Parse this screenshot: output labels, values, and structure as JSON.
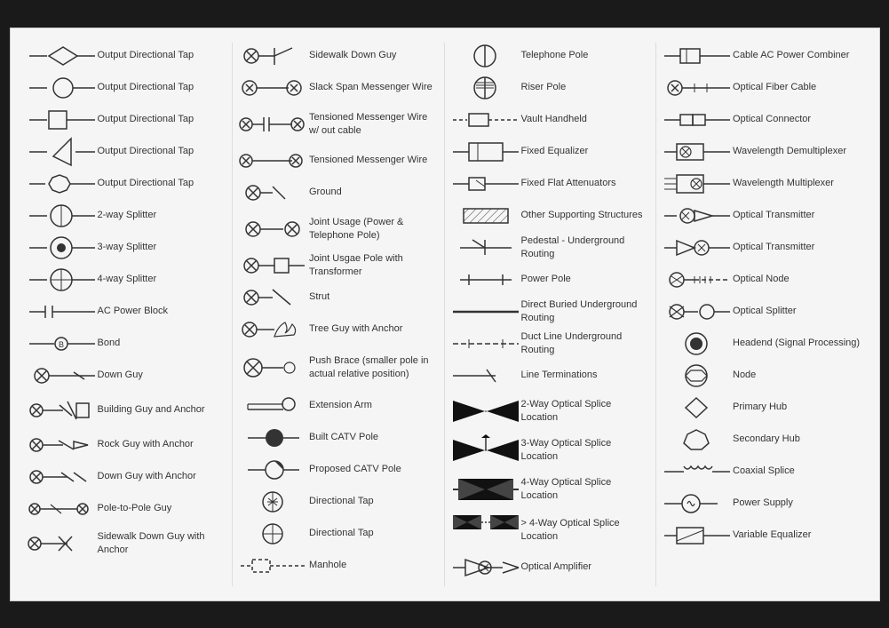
{
  "columns": [
    {
      "id": "col1",
      "items": [
        {
          "id": "odt-diamond",
          "label": "Output Directional Tap",
          "symbol": "diamond-line"
        },
        {
          "id": "odt-circle",
          "label": "Output Directional Tap",
          "symbol": "circle-line"
        },
        {
          "id": "odt-square",
          "label": "Output Directional Tap",
          "symbol": "square-line"
        },
        {
          "id": "odt-triangle",
          "label": "Output Directional Tap",
          "symbol": "triangle-line"
        },
        {
          "id": "odt-hex",
          "label": "Output Directional Tap",
          "symbol": "hex-line"
        },
        {
          "id": "2way",
          "label": "2-way Splitter",
          "symbol": "2way-splitter"
        },
        {
          "id": "3way",
          "label": "3-way Splitter",
          "symbol": "3way-splitter"
        },
        {
          "id": "4way",
          "label": "4-way Splitter",
          "symbol": "4way-splitter"
        },
        {
          "id": "acpb",
          "label": "AC Power Block",
          "symbol": "ac-power-block"
        },
        {
          "id": "bond",
          "label": "Bond",
          "symbol": "bond"
        },
        {
          "id": "downguy",
          "label": "Down Guy",
          "symbol": "down-guy"
        },
        {
          "id": "bldgguy",
          "label": "Building Guy and Anchor",
          "symbol": "building-guy"
        },
        {
          "id": "rockguy",
          "label": "Rock Guy with Anchor",
          "symbol": "rock-guy"
        },
        {
          "id": "downguyanchor",
          "label": "Down Guy with Anchor",
          "symbol": "down-guy-anchor"
        },
        {
          "id": "p2p",
          "label": "Pole-to-Pole Guy",
          "symbol": "pole-to-pole"
        },
        {
          "id": "sidewalkguy",
          "label": "Sidewalk Down Guy with Anchor",
          "symbol": "sidewalk-guy"
        }
      ]
    },
    {
      "id": "col2",
      "items": [
        {
          "id": "sidewalkdg",
          "label": "Sidewalk Down Guy",
          "symbol": "sidewalk-down-guy"
        },
        {
          "id": "slackspan",
          "label": "Slack Span Messenger Wire",
          "symbol": "slack-span"
        },
        {
          "id": "tensioned-wc",
          "label": "Tensioned Messenger Wire w/ out cable",
          "symbol": "tensioned-wo-cable"
        },
        {
          "id": "tensioned",
          "label": "Tensioned Messenger Wire",
          "symbol": "tensioned"
        },
        {
          "id": "ground",
          "label": "Ground",
          "symbol": "ground"
        },
        {
          "id": "joint-usage",
          "label": "Joint Usage (Power & Telephone Pole)",
          "symbol": "joint-usage"
        },
        {
          "id": "joint-trans",
          "label": "Joint Usgae Pole with Transformer",
          "symbol": "joint-transformer"
        },
        {
          "id": "strut",
          "label": "Strut",
          "symbol": "strut"
        },
        {
          "id": "treeguy",
          "label": "Tree Guy with Anchor",
          "symbol": "tree-guy"
        },
        {
          "id": "pushbrace",
          "label": "Push Brace (smaller pole in actual relative position)",
          "symbol": "push-brace"
        },
        {
          "id": "extarm",
          "label": "Extension Arm",
          "symbol": "ext-arm"
        },
        {
          "id": "builtcatv",
          "label": "Built CATV Pole",
          "symbol": "built-catv"
        },
        {
          "id": "proposedcatv",
          "label": "Proposed CATV Pole",
          "symbol": "proposed-catv"
        },
        {
          "id": "dirtap",
          "label": "Directional Tap",
          "symbol": "dir-tap-1"
        },
        {
          "id": "dirtap2",
          "label": "Directional Tap",
          "symbol": "dir-tap-2"
        },
        {
          "id": "manhole",
          "label": "Manhole",
          "symbol": "manhole"
        }
      ]
    },
    {
      "id": "col3",
      "items": [
        {
          "id": "telpole",
          "label": "Telephone Pole",
          "symbol": "telephone-pole"
        },
        {
          "id": "riserpole",
          "label": "Riser Pole",
          "symbol": "riser-pole"
        },
        {
          "id": "vaulthh",
          "label": "Vault Handheld",
          "symbol": "vault-handheld"
        },
        {
          "id": "fixedeq",
          "label": "Fixed Equalizer",
          "symbol": "fixed-equalizer"
        },
        {
          "id": "fixedflat",
          "label": "Fixed Flat Attenuators",
          "symbol": "fixed-flat-att"
        },
        {
          "id": "othersupport",
          "label": "Other Supporting Structures",
          "symbol": "other-support"
        },
        {
          "id": "pedestal",
          "label": "Pedestal - Underground Routing",
          "symbol": "pedestal"
        },
        {
          "id": "powerpole",
          "label": "Power Pole",
          "symbol": "power-pole"
        },
        {
          "id": "directburied",
          "label": "Direct Buried Underground Routing",
          "symbol": "direct-buried"
        },
        {
          "id": "ductline",
          "label": "Duct Line Underground Routing",
          "symbol": "duct-line"
        },
        {
          "id": "linetermination",
          "label": "Line Terminations",
          "symbol": "line-term"
        },
        {
          "id": "2way-optical",
          "label": "2-Way Optical Splice Location",
          "symbol": "2way-optical"
        },
        {
          "id": "3way-optical",
          "label": "3-Way Optical Splice Location",
          "symbol": "3way-optical"
        },
        {
          "id": "4way-optical",
          "label": "4-Way Optical Splice Location",
          "symbol": "4way-optical"
        },
        {
          "id": "4wayplus-optical",
          "label": "> 4-Way Optical Splice Location",
          "symbol": "4wayplus-optical"
        },
        {
          "id": "opticalamp",
          "label": "Optical Amplifier",
          "symbol": "optical-amp"
        }
      ]
    },
    {
      "id": "col4",
      "items": [
        {
          "id": "cableac",
          "label": "Cable AC Power Combiner",
          "symbol": "cable-ac"
        },
        {
          "id": "optfiber",
          "label": "Optical Fiber Cable",
          "symbol": "opt-fiber"
        },
        {
          "id": "optconn",
          "label": "Optical Connector",
          "symbol": "opt-connector"
        },
        {
          "id": "wavdemux",
          "label": "Wavelength Demultiplexer",
          "symbol": "wav-demux"
        },
        {
          "id": "wavmux",
          "label": "Wavelength Multiplexer",
          "symbol": "wav-mux"
        },
        {
          "id": "opttrans1",
          "label": "Optical Transmitter",
          "symbol": "opt-trans1"
        },
        {
          "id": "opttrans2",
          "label": "Optical Transmitter",
          "symbol": "opt-trans2"
        },
        {
          "id": "optnode",
          "label": "Optical Node",
          "symbol": "opt-node"
        },
        {
          "id": "optsplit",
          "label": "Optical Splitter",
          "symbol": "opt-splitter"
        },
        {
          "id": "headend",
          "label": "Headend (Signal Processing)",
          "symbol": "headend"
        },
        {
          "id": "node",
          "label": "Node",
          "symbol": "node-sym"
        },
        {
          "id": "primaryhub",
          "label": "Primary Hub",
          "symbol": "primary-hub"
        },
        {
          "id": "secondaryhub",
          "label": "Secondary Hub",
          "symbol": "secondary-hub"
        },
        {
          "id": "coaxsplice",
          "label": "Coaxial Splice",
          "symbol": "coax-splice"
        },
        {
          "id": "powersupply",
          "label": "Power Supply",
          "symbol": "power-supply"
        },
        {
          "id": "varequal",
          "label": "Variable Equalizer",
          "symbol": "var-equal"
        }
      ]
    }
  ]
}
